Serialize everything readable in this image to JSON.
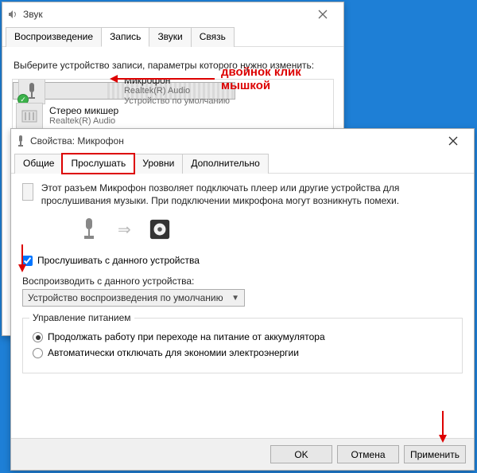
{
  "annotation": {
    "double_click_l1": "двойнок клик",
    "double_click_l2": "мышкой"
  },
  "win1": {
    "title": "Звук",
    "tabs": [
      "Воспроизведение",
      "Запись",
      "Звуки",
      "Связь"
    ],
    "active_tab_index": 1,
    "instruction": "Выберите устройство записи, параметры которого нужно изменить:",
    "devices": [
      {
        "name": "Микрофон",
        "driver": "Realtek(R) Audio",
        "status": "Устройство по умолчанию",
        "default": true
      },
      {
        "name": "Стерео микшер",
        "driver": "Realtek(R) Audio",
        "status": "",
        "default": false
      }
    ]
  },
  "win2": {
    "title": "Свойства: Микрофон",
    "tabs": [
      "Общие",
      "Прослушать",
      "Уровни",
      "Дополнительно"
    ],
    "active_tab_index": 1,
    "desc": "Этот разъем Микрофон позволяет подключать плеер или другие устройства для прослушивания музыки. При подключении микрофона могут возникнуть помехи.",
    "listen_cb": "Прослушивать с данного устройства",
    "playback_label": "Воспроизводить с данного устройства:",
    "playback_value": "Устройство воспроизведения по умолчанию",
    "power_group": "Управление питанием",
    "power_opt1": "Продолжать работу при переходе на питание от аккумулятора",
    "power_opt2": "Автоматически отключать для экономии электроэнергии",
    "buttons": {
      "ok": "OK",
      "cancel": "Отмена",
      "apply": "Применить"
    }
  }
}
